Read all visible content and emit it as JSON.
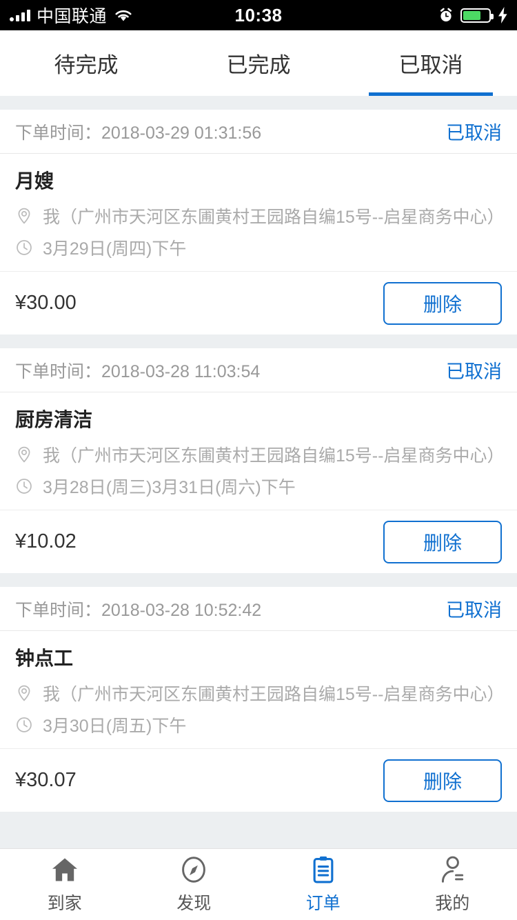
{
  "status_bar": {
    "carrier": "中国联通",
    "time": "10:38",
    "icons": [
      "signal-icon",
      "wifi-icon",
      "alarm-icon",
      "battery-icon",
      "charging-bolt-icon"
    ],
    "battery_level_percent": 70
  },
  "tabs": {
    "items": [
      {
        "label": "待完成",
        "active": false
      },
      {
        "label": "已完成",
        "active": false
      },
      {
        "label": "已取消",
        "active": true
      }
    ],
    "active_color": "#1070d0"
  },
  "order_time_label": "下单时间：",
  "delete_label": "删除",
  "orders": [
    {
      "order_time": "2018-03-29 01:31:56",
      "status": "已取消",
      "service": "月嫂",
      "address": "我（广州市天河区东圃黄村王园路自编15号--启星商务中心）",
      "schedule": "3月29日(周四)下午",
      "price": "¥30.00"
    },
    {
      "order_time": "2018-03-28 11:03:54",
      "status": "已取消",
      "service": "厨房清洁",
      "address": "我（广州市天河区东圃黄村王园路自编15号--启星商务中心）",
      "schedule": "3月28日(周三)3月31日(周六)下午",
      "price": "¥10.02"
    },
    {
      "order_time": "2018-03-28 10:52:42",
      "status": "已取消",
      "service": "钟点工",
      "address": "我（广州市天河区东圃黄村王园路自编15号--启星商务中心）",
      "schedule": "3月30日(周五)下午",
      "price": "¥30.07"
    }
  ],
  "tabbar": {
    "items": [
      {
        "label": "到家",
        "icon": "home-icon",
        "active": false
      },
      {
        "label": "发现",
        "icon": "compass-icon",
        "active": false
      },
      {
        "label": "订单",
        "icon": "clipboard-icon",
        "active": true
      },
      {
        "label": "我的",
        "icon": "person-icon",
        "active": false
      }
    ]
  }
}
